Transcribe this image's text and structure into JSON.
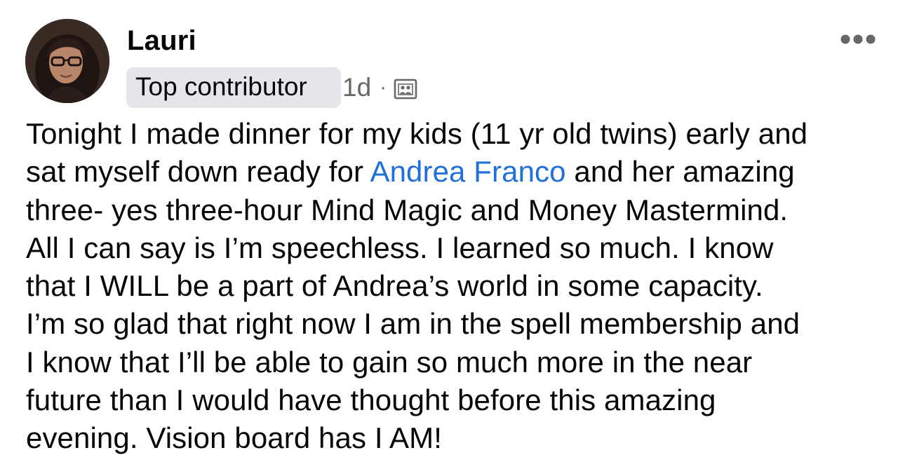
{
  "post": {
    "author": {
      "name": "Lauri",
      "avatar_icon": "profile-photo"
    },
    "badge": "Top contributor",
    "time": "1d",
    "separator": "·",
    "audience_icon": "group-members-icon",
    "more_icon": "more-options-icon",
    "body": {
      "line1": "Tonight I made dinner for my kids (11 yr old twins) early and",
      "line2_before": "sat myself down ready for ",
      "line2_mention": "Andrea Franco",
      "line2_after": " and her amazing",
      "line3": "three- yes three-hour Mind Magic and Money Mastermind.",
      "line4": "All I can say is I’m speechless. I learned so much. I know",
      "line5": "that I WILL be a part of Andrea’s world in some capacity.",
      "line6": "I’m so glad that right now I am in the spell membership and",
      "line7": "I know that I’ll be able to gain so much more in the near",
      "line8": "future than I would have thought before this amazing",
      "line9": "evening. Vision board has I AM!"
    },
    "colors": {
      "text": "#050505",
      "secondary_text": "#65676b",
      "mention": "#216fdb",
      "badge_bg": "#e4e6eb"
    }
  }
}
